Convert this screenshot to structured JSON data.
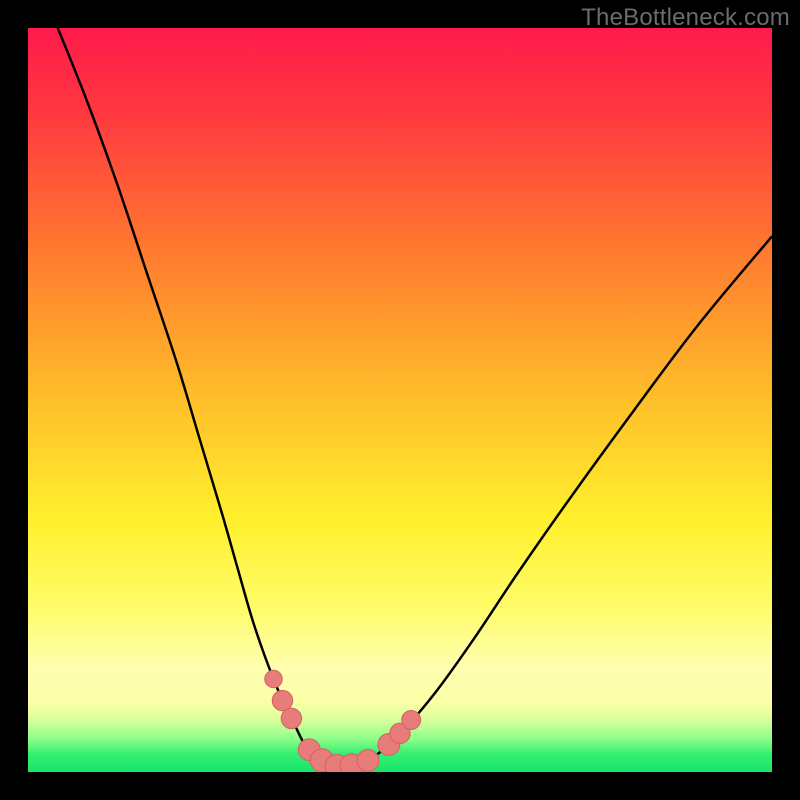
{
  "watermark": "TheBottleneck.com",
  "colors": {
    "border": "#000000",
    "curve": "#000000",
    "points_fill": "#e77c7a",
    "points_stroke": "#d46260",
    "green_band": "#17e66a",
    "gradient_stops": [
      {
        "offset": 0.0,
        "color": "#ff1a4b"
      },
      {
        "offset": 0.12,
        "color": "#ff3a3f"
      },
      {
        "offset": 0.3,
        "color": "#ff7a2f"
      },
      {
        "offset": 0.5,
        "color": "#ffbf2a"
      },
      {
        "offset": 0.66,
        "color": "#fff02c"
      },
      {
        "offset": 0.78,
        "color": "#fffc6a"
      },
      {
        "offset": 0.86,
        "color": "#ffffb0"
      },
      {
        "offset": 0.905,
        "color": "#fcffa8"
      },
      {
        "offset": 0.93,
        "color": "#d9ff9a"
      },
      {
        "offset": 0.955,
        "color": "#8fff8a"
      },
      {
        "offset": 0.975,
        "color": "#37ef72"
      },
      {
        "offset": 1.0,
        "color": "#17e66a"
      }
    ]
  },
  "chart_data": {
    "type": "line",
    "title": "",
    "xlabel": "",
    "ylabel": "",
    "xlim": [
      0,
      100
    ],
    "ylim": [
      0,
      100
    ],
    "series": [
      {
        "name": "curve-left",
        "x": [
          4,
          8,
          12,
          16,
          20,
          23,
          26,
          28,
          30,
          31.5,
          33,
          34.5,
          36,
          37,
          38,
          39
        ],
        "y": [
          100,
          90,
          79,
          67,
          55,
          45,
          35,
          28,
          21,
          16.5,
          12.5,
          9,
          6,
          4,
          2.6,
          1.6
        ]
      },
      {
        "name": "curve-bottom",
        "x": [
          39,
          40,
          41,
          42,
          43,
          44,
          45,
          46
        ],
        "y": [
          1.6,
          1.1,
          0.85,
          0.75,
          0.8,
          0.95,
          1.25,
          1.8
        ]
      },
      {
        "name": "curve-right",
        "x": [
          46,
          48,
          51,
          55,
          60,
          66,
          73,
          81,
          90,
          100
        ],
        "y": [
          1.8,
          3.2,
          6.2,
          11,
          18,
          27,
          37,
          48,
          60,
          72
        ]
      }
    ],
    "points": [
      {
        "x": 33.0,
        "y": 12.5,
        "r": 1.2
      },
      {
        "x": 34.2,
        "y": 9.6,
        "r": 1.4
      },
      {
        "x": 35.4,
        "y": 7.2,
        "r": 1.4
      },
      {
        "x": 37.8,
        "y": 3.0,
        "r": 1.5
      },
      {
        "x": 39.5,
        "y": 1.55,
        "r": 1.6
      },
      {
        "x": 41.5,
        "y": 0.8,
        "r": 1.6
      },
      {
        "x": 43.5,
        "y": 0.85,
        "r": 1.6
      },
      {
        "x": 45.7,
        "y": 1.55,
        "r": 1.5
      },
      {
        "x": 48.5,
        "y": 3.7,
        "r": 1.5
      },
      {
        "x": 50.0,
        "y": 5.2,
        "r": 1.4
      },
      {
        "x": 51.5,
        "y": 7.0,
        "r": 1.3
      }
    ]
  }
}
